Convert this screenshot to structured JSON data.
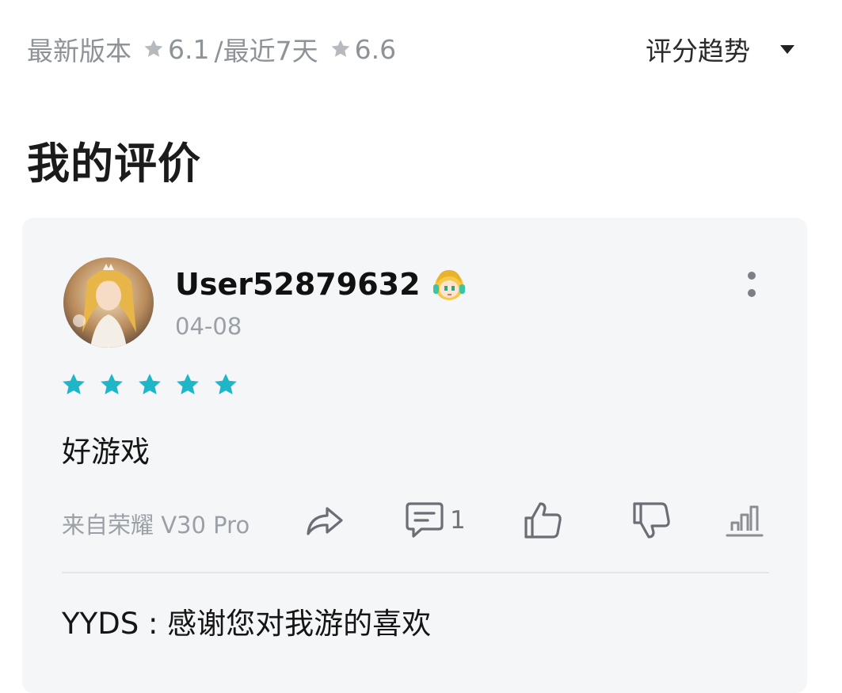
{
  "header": {
    "latest_label": "最新版本",
    "latest_score": "6.1",
    "separator_recent": "/最近7天",
    "recent_score": "6.6",
    "trend_label": "评分趋势"
  },
  "section_title": "我的评价",
  "review": {
    "username": "User52879632",
    "date": "04-08",
    "rating_stars": 5,
    "text": "好游戏",
    "device": "来自荣耀 V30 Pro",
    "comment_count": "1",
    "reply": "YYDS : 感谢您对我游的喜欢"
  },
  "colors": {
    "accent_star": "#1fb6c8",
    "grey_star": "#b6babe",
    "card_bg": "#f5f6f8"
  },
  "icons": [
    "star-icon",
    "caret-down-icon",
    "more-icon",
    "share-icon",
    "comment-icon",
    "thumbs-up-icon",
    "thumbs-down-icon",
    "chart-icon"
  ]
}
